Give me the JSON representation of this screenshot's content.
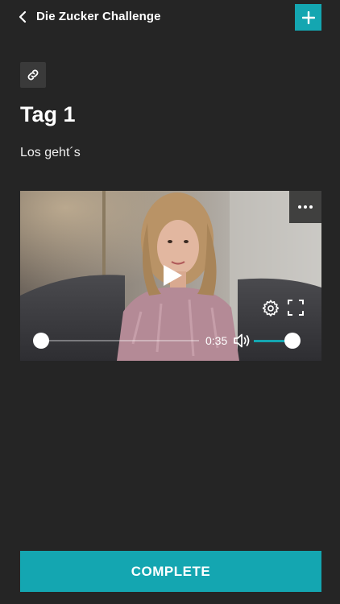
{
  "header": {
    "title": "Die Zucker Challenge",
    "back_icon": "chevron-left-icon",
    "add_icon": "plus-icon"
  },
  "content": {
    "link_icon": "link-icon",
    "title": "Tag 1",
    "subtitle": "Los geht´s"
  },
  "video_player": {
    "current_time": "0:35",
    "progress": 0.0,
    "volume": 1.0,
    "icons": [
      "more-horizontal-icon",
      "play-icon",
      "settings-icon",
      "fullscreen-icon",
      "volume-icon"
    ]
  },
  "footer": {
    "complete_label": "COMPLETE"
  },
  "colors": {
    "accent": "#14a6b1",
    "background": "#252525"
  }
}
